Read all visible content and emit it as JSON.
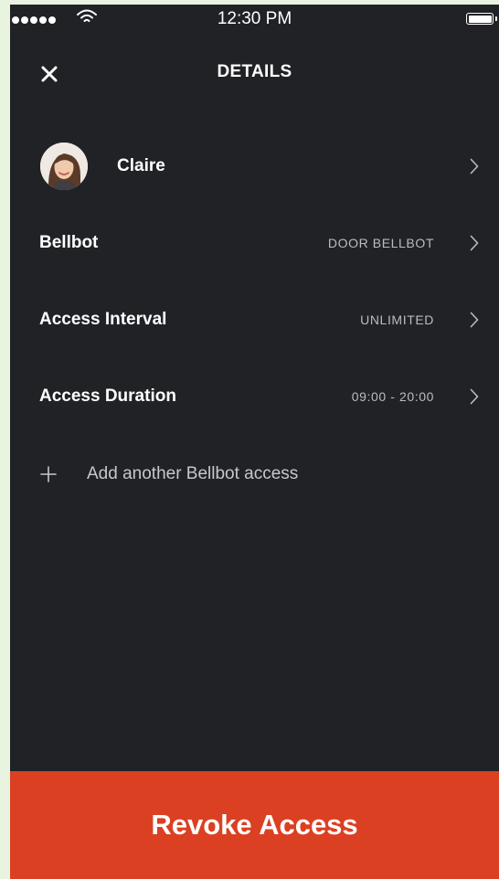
{
  "status_bar": {
    "time": "12:30 PM",
    "signal_icon": "signal-dots-icon",
    "wifi_icon": "wifi-icon",
    "battery_icon": "battery-icon",
    "battery_level": 1.0
  },
  "header": {
    "close_icon": "close-icon",
    "title": "DETAILS"
  },
  "user": {
    "name": "Claire",
    "avatar_icon": "avatar"
  },
  "rows": [
    {
      "label": "Bellbot",
      "value": "DOOR BELLBOT"
    },
    {
      "label": "Access Interval",
      "value": "UNLIMITED"
    },
    {
      "label": "Access Duration",
      "value": "09:00 - 20:00"
    }
  ],
  "add_access": {
    "icon": "plus-icon",
    "label": "Add another Bellbot access"
  },
  "revoke_button": {
    "label": "Revoke Access",
    "color": "#db4023"
  },
  "colors": {
    "background": "#212226",
    "accent": "#db4023",
    "muted_text": "#b9bcc4"
  }
}
